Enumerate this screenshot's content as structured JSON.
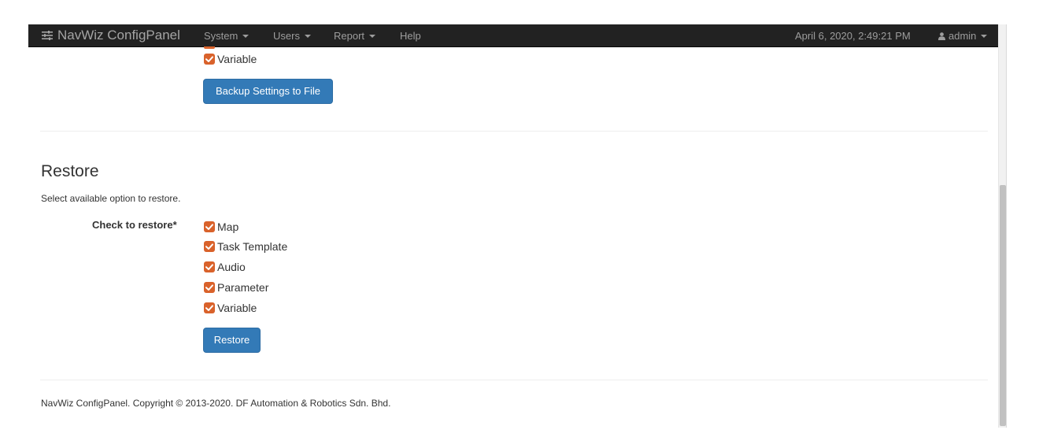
{
  "navbar": {
    "brand": "NavWiz ConfigPanel",
    "brand_icon": "sliders-icon",
    "menu": [
      {
        "label": "System",
        "dropdown": true
      },
      {
        "label": "Users",
        "dropdown": true
      },
      {
        "label": "Report",
        "dropdown": true
      },
      {
        "label": "Help",
        "dropdown": false
      }
    ],
    "datetime": "April 6, 2020, 2:49:21 PM",
    "user": "admin",
    "user_icon": "user-icon",
    "background": "#222222"
  },
  "backup": {
    "visible_options": [
      {
        "label": "Variable",
        "checked": true
      }
    ],
    "button_label": "Backup Settings to File"
  },
  "restore": {
    "title": "Restore",
    "description": "Select available option to restore.",
    "check_label": "Check to restore*",
    "options": [
      {
        "label": "Map",
        "checked": true
      },
      {
        "label": "Task Template",
        "checked": true
      },
      {
        "label": "Audio",
        "checked": true
      },
      {
        "label": "Parameter",
        "checked": true
      },
      {
        "label": "Variable",
        "checked": true
      }
    ],
    "button_label": "Restore"
  },
  "footer": {
    "text": "NavWiz ConfigPanel. Copyright © 2013-2020. DF Automation & Robotics Sdn. Bhd."
  },
  "colors": {
    "checkbox": "#d9622b",
    "primary_button": "#337ab7",
    "navbar": "#222222"
  }
}
